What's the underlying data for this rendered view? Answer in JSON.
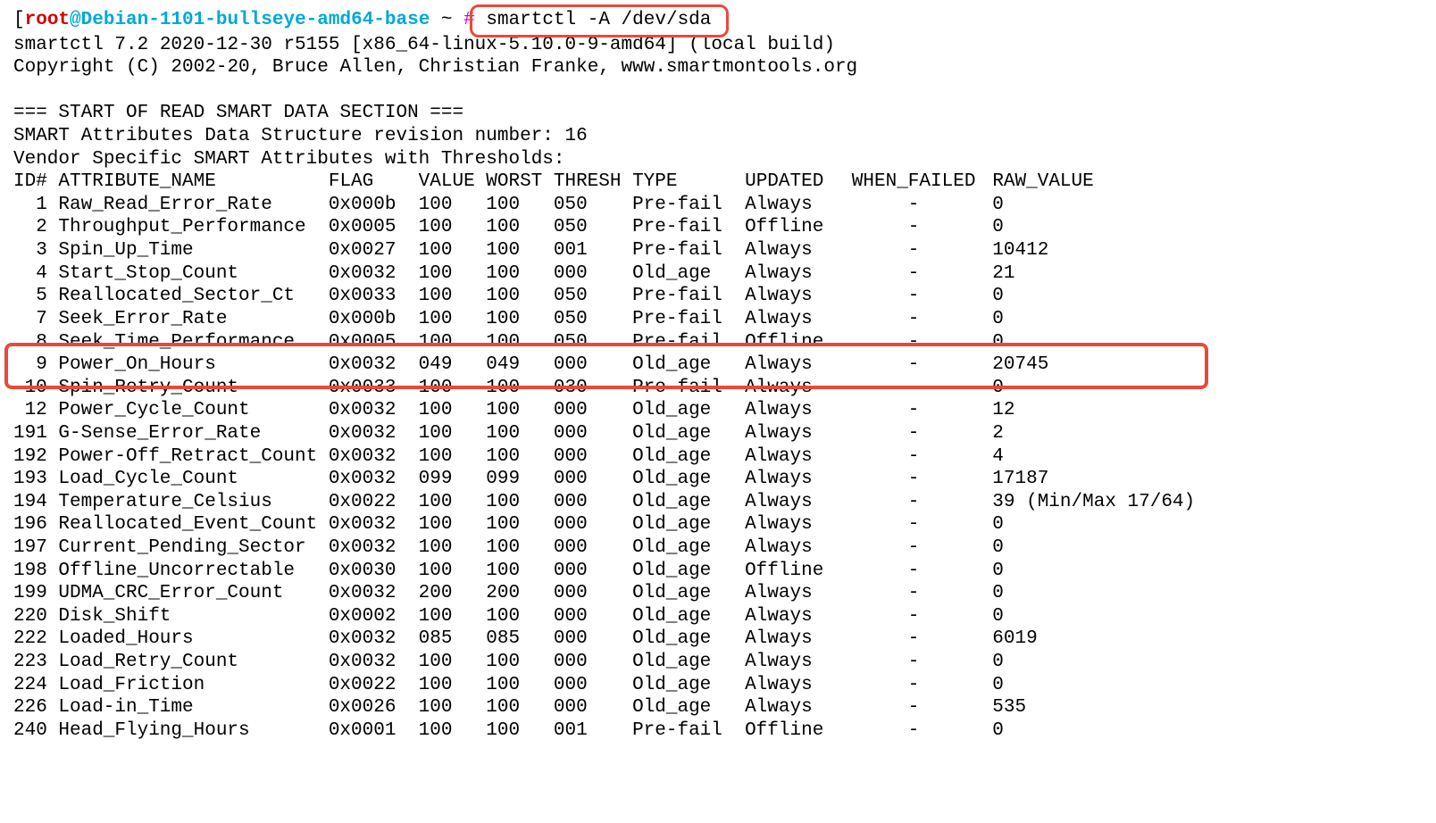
{
  "prompt": {
    "bracket_open": "[",
    "user": "root",
    "at": "@",
    "host": "Debian-1101-bullseye-amd64-base",
    "path": " ~ ",
    "hash": "#",
    "command": " smartctl -A /dev/sda"
  },
  "banner": {
    "line1": "smartctl 7.2 2020-12-30 r5155 [x86_64-linux-5.10.0-9-amd64] (local build)",
    "line2": "Copyright (C) 2002-20, Bruce Allen, Christian Franke, www.smartmontools.org"
  },
  "section_header": "=== START OF READ SMART DATA SECTION ===",
  "rev_line": "SMART Attributes Data Structure revision number: 16",
  "vendor_line": "Vendor Specific SMART Attributes with Thresholds:",
  "headers": {
    "id": "ID#",
    "name": "ATTRIBUTE_NAME",
    "flag": "FLAG",
    "value": "VALUE",
    "worst": "WORST",
    "thresh": "THRESH",
    "type": "TYPE",
    "updated": "UPDATED",
    "when": "WHEN_FAILED",
    "raw": "RAW_VALUE"
  },
  "rows": [
    {
      "id": "1",
      "name": "Raw_Read_Error_Rate",
      "flag": "0x000b",
      "value": "100",
      "worst": "100",
      "thresh": "050",
      "type": "Pre-fail",
      "updated": "Always",
      "when": "-",
      "raw": "0"
    },
    {
      "id": "2",
      "name": "Throughput_Performance",
      "flag": "0x0005",
      "value": "100",
      "worst": "100",
      "thresh": "050",
      "type": "Pre-fail",
      "updated": "Offline",
      "when": "-",
      "raw": "0"
    },
    {
      "id": "3",
      "name": "Spin_Up_Time",
      "flag": "0x0027",
      "value": "100",
      "worst": "100",
      "thresh": "001",
      "type": "Pre-fail",
      "updated": "Always",
      "when": "-",
      "raw": "10412"
    },
    {
      "id": "4",
      "name": "Start_Stop_Count",
      "flag": "0x0032",
      "value": "100",
      "worst": "100",
      "thresh": "000",
      "type": "Old_age",
      "updated": "Always",
      "when": "-",
      "raw": "21"
    },
    {
      "id": "5",
      "name": "Reallocated_Sector_Ct",
      "flag": "0x0033",
      "value": "100",
      "worst": "100",
      "thresh": "050",
      "type": "Pre-fail",
      "updated": "Always",
      "when": "-",
      "raw": "0"
    },
    {
      "id": "7",
      "name": "Seek_Error_Rate",
      "flag": "0x000b",
      "value": "100",
      "worst": "100",
      "thresh": "050",
      "type": "Pre-fail",
      "updated": "Always",
      "when": "-",
      "raw": "0"
    },
    {
      "id": "8",
      "name": "Seek_Time_Performance",
      "flag": "0x0005",
      "value": "100",
      "worst": "100",
      "thresh": "050",
      "type": "Pre-fail",
      "updated": "Offline",
      "when": "-",
      "raw": "0"
    },
    {
      "id": "9",
      "name": "Power_On_Hours",
      "flag": "0x0032",
      "value": "049",
      "worst": "049",
      "thresh": "000",
      "type": "Old_age",
      "updated": "Always",
      "when": "-",
      "raw": "20745"
    },
    {
      "id": "10",
      "name": "Spin_Retry_Count",
      "flag": "0x0033",
      "value": "100",
      "worst": "100",
      "thresh": "030",
      "type": "Pre-fail",
      "updated": "Always",
      "when": "-",
      "raw": "0"
    },
    {
      "id": "12",
      "name": "Power_Cycle_Count",
      "flag": "0x0032",
      "value": "100",
      "worst": "100",
      "thresh": "000",
      "type": "Old_age",
      "updated": "Always",
      "when": "-",
      "raw": "12"
    },
    {
      "id": "191",
      "name": "G-Sense_Error_Rate",
      "flag": "0x0032",
      "value": "100",
      "worst": "100",
      "thresh": "000",
      "type": "Old_age",
      "updated": "Always",
      "when": "-",
      "raw": "2"
    },
    {
      "id": "192",
      "name": "Power-Off_Retract_Count",
      "flag": "0x0032",
      "value": "100",
      "worst": "100",
      "thresh": "000",
      "type": "Old_age",
      "updated": "Always",
      "when": "-",
      "raw": "4"
    },
    {
      "id": "193",
      "name": "Load_Cycle_Count",
      "flag": "0x0032",
      "value": "099",
      "worst": "099",
      "thresh": "000",
      "type": "Old_age",
      "updated": "Always",
      "when": "-",
      "raw": "17187"
    },
    {
      "id": "194",
      "name": "Temperature_Celsius",
      "flag": "0x0022",
      "value": "100",
      "worst": "100",
      "thresh": "000",
      "type": "Old_age",
      "updated": "Always",
      "when": "-",
      "raw": "39 (Min/Max 17/64)"
    },
    {
      "id": "196",
      "name": "Reallocated_Event_Count",
      "flag": "0x0032",
      "value": "100",
      "worst": "100",
      "thresh": "000",
      "type": "Old_age",
      "updated": "Always",
      "when": "-",
      "raw": "0"
    },
    {
      "id": "197",
      "name": "Current_Pending_Sector",
      "flag": "0x0032",
      "value": "100",
      "worst": "100",
      "thresh": "000",
      "type": "Old_age",
      "updated": "Always",
      "when": "-",
      "raw": "0"
    },
    {
      "id": "198",
      "name": "Offline_Uncorrectable",
      "flag": "0x0030",
      "value": "100",
      "worst": "100",
      "thresh": "000",
      "type": "Old_age",
      "updated": "Offline",
      "when": "-",
      "raw": "0"
    },
    {
      "id": "199",
      "name": "UDMA_CRC_Error_Count",
      "flag": "0x0032",
      "value": "200",
      "worst": "200",
      "thresh": "000",
      "type": "Old_age",
      "updated": "Always",
      "when": "-",
      "raw": "0"
    },
    {
      "id": "220",
      "name": "Disk_Shift",
      "flag": "0x0002",
      "value": "100",
      "worst": "100",
      "thresh": "000",
      "type": "Old_age",
      "updated": "Always",
      "when": "-",
      "raw": "0"
    },
    {
      "id": "222",
      "name": "Loaded_Hours",
      "flag": "0x0032",
      "value": "085",
      "worst": "085",
      "thresh": "000",
      "type": "Old_age",
      "updated": "Always",
      "when": "-",
      "raw": "6019"
    },
    {
      "id": "223",
      "name": "Load_Retry_Count",
      "flag": "0x0032",
      "value": "100",
      "worst": "100",
      "thresh": "000",
      "type": "Old_age",
      "updated": "Always",
      "when": "-",
      "raw": "0"
    },
    {
      "id": "224",
      "name": "Load_Friction",
      "flag": "0x0022",
      "value": "100",
      "worst": "100",
      "thresh": "000",
      "type": "Old_age",
      "updated": "Always",
      "when": "-",
      "raw": "0"
    },
    {
      "id": "226",
      "name": "Load-in_Time",
      "flag": "0x0026",
      "value": "100",
      "worst": "100",
      "thresh": "000",
      "type": "Old_age",
      "updated": "Always",
      "when": "-",
      "raw": "535"
    },
    {
      "id": "240",
      "name": "Head_Flying_Hours",
      "flag": "0x0001",
      "value": "100",
      "worst": "100",
      "thresh": "001",
      "type": "Pre-fail",
      "updated": "Offline",
      "when": "-",
      "raw": "0"
    }
  ],
  "highlight_row_index": 7
}
